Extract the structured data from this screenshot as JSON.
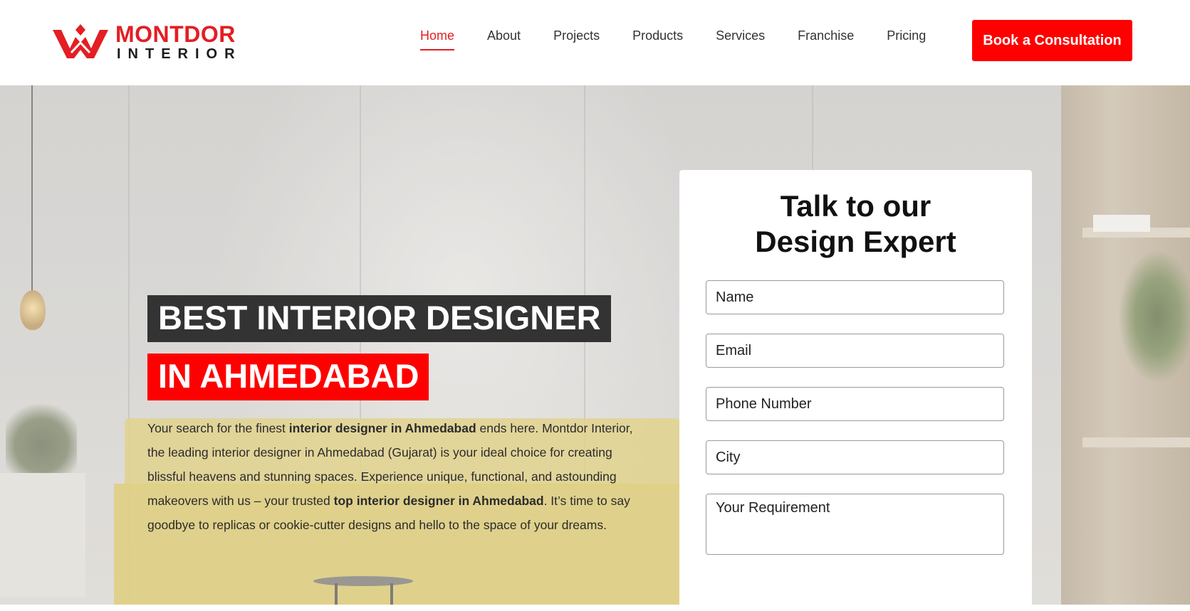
{
  "header": {
    "logo": {
      "name": "MONTDOR",
      "sub": "INTERIOR"
    },
    "nav": [
      {
        "label": "Home",
        "active": true
      },
      {
        "label": "About",
        "active": false
      },
      {
        "label": "Projects",
        "active": false
      },
      {
        "label": "Products",
        "active": false
      },
      {
        "label": "Services",
        "active": false
      },
      {
        "label": "Franchise",
        "active": false
      },
      {
        "label": "Pricing",
        "active": false
      }
    ],
    "cta_label": "Book a Consultation"
  },
  "hero": {
    "headline_line1": "BEST INTERIOR DESIGNER",
    "headline_line2": "IN AHMEDABAD",
    "intro": {
      "p1": "Your search for the finest ",
      "b1": "interior designer in Ahmedabad",
      "p2": " ends here. Montdor Interior, the leading interior designer in Ahmedabad (Gujarat) is your ideal choice for creating blissful heavens and stunning spaces. Experience unique, functional, and astounding makeovers with us – your trusted ",
      "b2": "top interior designer in Ahmedabad",
      "p3": ". It’s time to say goodbye to replicas or cookie-cutter designs and hello to the space of your dreams."
    }
  },
  "form": {
    "title_line1": "Talk to our",
    "title_line2": "Design Expert",
    "fields": {
      "name": "Name",
      "email": "Email",
      "phone": "Phone Number",
      "city": "City",
      "requirement": "Your Requirement"
    }
  },
  "colors": {
    "brand_red": "#e31e24",
    "cta_red": "#ff0000",
    "headline_dark": "#333333"
  },
  "icons": {
    "logo_mark": "crown-monogram-icon"
  }
}
